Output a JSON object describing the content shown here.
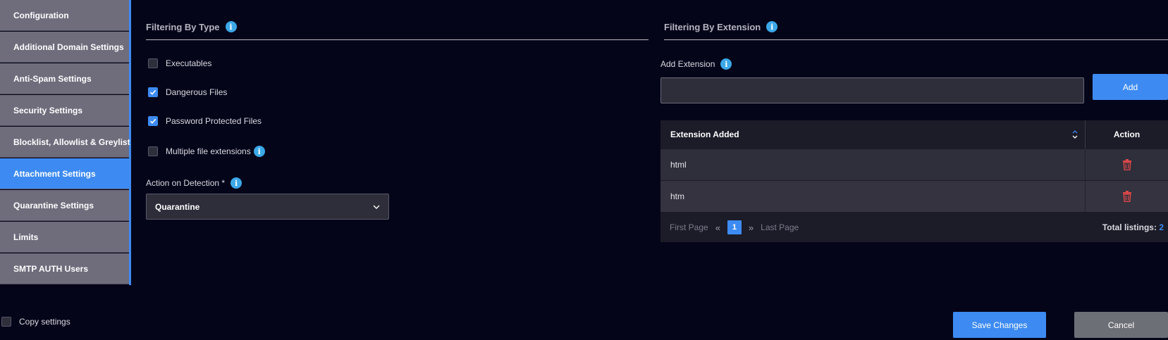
{
  "sidebar": {
    "items": [
      {
        "label": "Configuration",
        "active": false
      },
      {
        "label": "Additional Domain Settings",
        "active": false
      },
      {
        "label": "Anti-Spam Settings",
        "active": false
      },
      {
        "label": "Security Settings",
        "active": false
      },
      {
        "label": "Blocklist, Allowlist & Greylist",
        "active": false
      },
      {
        "label": "Attachment Settings",
        "active": true
      },
      {
        "label": "Quarantine Settings",
        "active": false
      },
      {
        "label": "Limits",
        "active": false
      },
      {
        "label": "SMTP AUTH Users",
        "active": false
      }
    ]
  },
  "copy_settings": {
    "label": "Copy settings",
    "checked": false
  },
  "filter_type": {
    "title": "Filtering By Type",
    "options": [
      {
        "label": "Executables",
        "checked": false
      },
      {
        "label": "Dangerous Files",
        "checked": true
      },
      {
        "label": "Password Protected Files",
        "checked": true
      },
      {
        "label": "Multiple file extensions",
        "checked": false
      }
    ],
    "action_label": "Action on Detection *",
    "action_value": "Quarantine"
  },
  "filter_ext": {
    "title": "Filtering By Extension",
    "add_label": "Add Extension",
    "input_value": "",
    "add_button": "Add",
    "table": {
      "col_extension": "Extension Added",
      "col_action": "Action",
      "rows": [
        {
          "extension": "html"
        },
        {
          "extension": "htm"
        }
      ]
    },
    "pager": {
      "first": "First Page",
      "page": "1",
      "last": "Last Page",
      "total_label": "Total listings:",
      "total_count": "2"
    }
  },
  "footer": {
    "save_label": "Save Changes",
    "cancel_label": "Cancel"
  },
  "colors": {
    "accent": "#3d8bf2",
    "background": "#05051a",
    "delete": "#e04848",
    "info": "#3ba8e8"
  }
}
